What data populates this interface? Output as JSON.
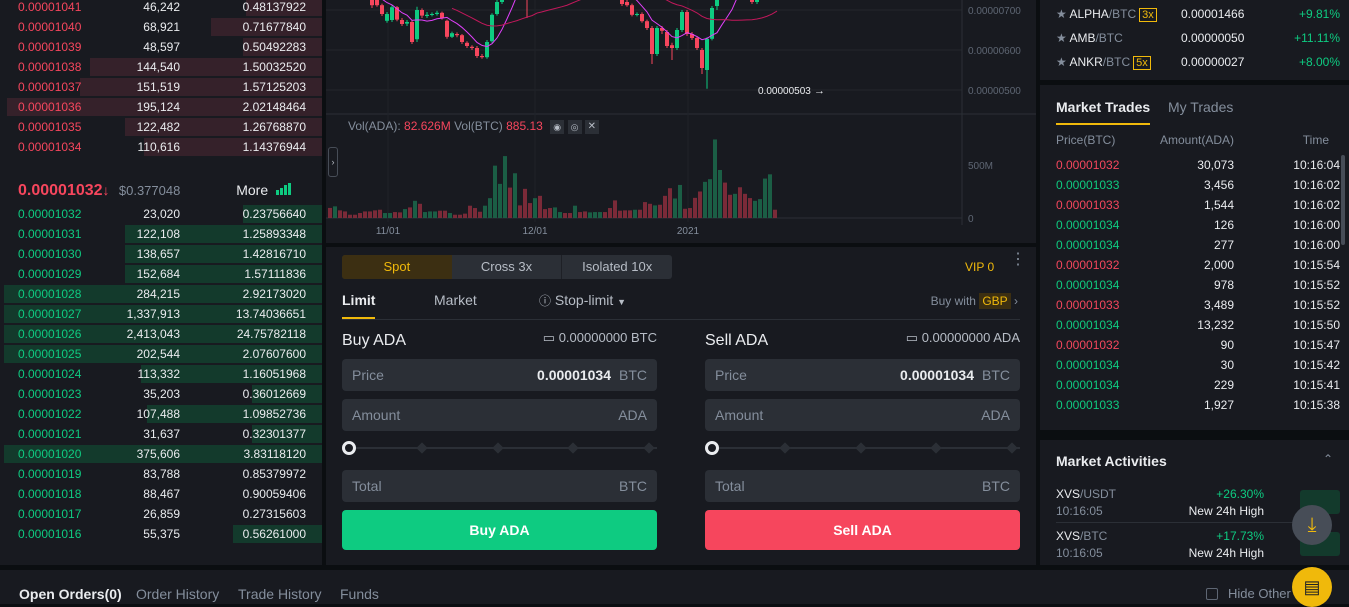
{
  "orderbook": {
    "asks": [
      {
        "price": "0.00001041",
        "amount": "46,242",
        "total": "0.48137922",
        "depth": 0.24
      },
      {
        "price": "0.00001040",
        "amount": "68,921",
        "total": "0.71677840",
        "depth": 0.35
      },
      {
        "price": "0.00001039",
        "amount": "48,597",
        "total": "0.50492283",
        "depth": 0.25
      },
      {
        "price": "0.00001038",
        "amount": "144,540",
        "total": "1.50032520",
        "depth": 0.73
      },
      {
        "price": "0.00001037",
        "amount": "151,519",
        "total": "1.57125203",
        "depth": 0.76
      },
      {
        "price": "0.00001036",
        "amount": "195,124",
        "total": "2.02148464",
        "depth": 0.99
      },
      {
        "price": "0.00001035",
        "amount": "122,482",
        "total": "1.26768870",
        "depth": 0.62
      },
      {
        "price": "0.00001034",
        "amount": "110,616",
        "total": "1.14376944",
        "depth": 0.56
      }
    ],
    "last_price": "0.00001032",
    "last_arrow": "↓",
    "last_usd": "$0.377048",
    "more": "More",
    "bids": [
      {
        "price": "0.00001032",
        "amount": "23,020",
        "total": "0.23756640",
        "depth": 0.25
      },
      {
        "price": "0.00001031",
        "amount": "122,108",
        "total": "1.25893348",
        "depth": 0.62
      },
      {
        "price": "0.00001030",
        "amount": "138,657",
        "total": "1.42816710",
        "depth": 0.62
      },
      {
        "price": "0.00001029",
        "amount": "152,684",
        "total": "1.57111836",
        "depth": 0.62
      },
      {
        "price": "0.00001028",
        "amount": "284,215",
        "total": "2.92173020",
        "depth": 1
      },
      {
        "price": "0.00001027",
        "amount": "1,337,913",
        "total": "13.74036651",
        "depth": 1
      },
      {
        "price": "0.00001026",
        "amount": "2,413,043",
        "total": "24.75782118",
        "depth": 1
      },
      {
        "price": "0.00001025",
        "amount": "202,544",
        "total": "2.07607600",
        "depth": 1
      },
      {
        "price": "0.00001024",
        "amount": "113,332",
        "total": "1.16051968",
        "depth": 0.57
      },
      {
        "price": "0.00001023",
        "amount": "35,203",
        "total": "0.36012669",
        "depth": 0.22
      },
      {
        "price": "0.00001022",
        "amount": "107,488",
        "total": "1.09852736",
        "depth": 0.55
      },
      {
        "price": "0.00001021",
        "amount": "31,637",
        "total": "0.32301377",
        "depth": 0.22
      },
      {
        "price": "0.00001020",
        "amount": "375,606",
        "total": "3.83118120",
        "depth": 1
      },
      {
        "price": "0.00001019",
        "amount": "83,788",
        "total": "0.85379972",
        "depth": 0
      },
      {
        "price": "0.00001018",
        "amount": "88,467",
        "total": "0.90059406",
        "depth": 0
      },
      {
        "price": "0.00001017",
        "amount": "26,859",
        "total": "0.27315603",
        "depth": 0
      },
      {
        "price": "0.00001016",
        "amount": "55,375",
        "total": "0.56261000",
        "depth": 0.28
      }
    ]
  },
  "chart": {
    "price_ticks": [
      "0.00000700",
      "0.00000600",
      "0.00000500"
    ],
    "low_marker": "0.00000503",
    "vol_label": "Vol(ADA):",
    "vol_ada": "82.626M",
    "vol_btc_label": "Vol(BTC)",
    "vol_btc": "885.13",
    "vol_ticks": [
      "500M",
      "0"
    ],
    "date_ticks": [
      "11/01",
      "12/01",
      "2021"
    ],
    "colors": {
      "up": "#0ecb81",
      "down": "#f6465d",
      "ma1": "#e040fb",
      "ma2": "#c2185b"
    }
  },
  "chart_data": {
    "type": "candlestick",
    "price_unit": "1e-8 BTC",
    "candles": [
      [
        780,
        770,
        790,
        760
      ],
      [
        770,
        775,
        785,
        765
      ],
      [
        775,
        768,
        780,
        760
      ],
      [
        768,
        760,
        772,
        750
      ],
      [
        760,
        752,
        765,
        745
      ],
      [
        752,
        748,
        758,
        740
      ],
      [
        748,
        742,
        752,
        736
      ],
      [
        742,
        735,
        748,
        730
      ],
      [
        730,
        712,
        740,
        705
      ],
      [
        725,
        712,
        730,
        708
      ],
      [
        712,
        690,
        716,
        685
      ],
      [
        673,
        690,
        695,
        668
      ],
      [
        675,
        707,
        712,
        670
      ],
      [
        707,
        676,
        710,
        672
      ],
      [
        675,
        665,
        680,
        660
      ],
      [
        666,
        670,
        675,
        660
      ],
      [
        670,
        620,
        675,
        615
      ],
      [
        627,
        700,
        708,
        620
      ],
      [
        700,
        686,
        704,
        680
      ],
      [
        685,
        688,
        695,
        680
      ],
      [
        688,
        690,
        694,
        684
      ],
      [
        690,
        693,
        698,
        686
      ],
      [
        693,
        680,
        696,
        676
      ],
      [
        673,
        633,
        676,
        628
      ],
      [
        633,
        642,
        646,
        630
      ],
      [
        640,
        637,
        644,
        632
      ],
      [
        637,
        620,
        640,
        615
      ],
      [
        618,
        610,
        622,
        605
      ],
      [
        608,
        605,
        612,
        600
      ],
      [
        605,
        585,
        610,
        580
      ],
      [
        585,
        582,
        590,
        578
      ],
      [
        582,
        620,
        625,
        578
      ],
      [
        622,
        688,
        692,
        618
      ],
      [
        690,
        720,
        730,
        686
      ],
      [
        720,
        760,
        770,
        715
      ],
      [
        760,
        790,
        800,
        755
      ],
      [
        790,
        780,
        800,
        770
      ],
      [
        780,
        795,
        805,
        775
      ],
      [
        795,
        790,
        800,
        785
      ],
      [
        790,
        770,
        795,
        680
      ],
      [
        770,
        765,
        780,
        760
      ],
      [
        765,
        780,
        785,
        760
      ],
      [
        780,
        775,
        790,
        770
      ],
      [
        775,
        770,
        782,
        765
      ],
      [
        770,
        765,
        775,
        760
      ],
      [
        765,
        770,
        775,
        760
      ],
      [
        770,
        775,
        780,
        765
      ],
      [
        775,
        770,
        780,
        765
      ],
      [
        770,
        765,
        775,
        760
      ],
      [
        765,
        770,
        775,
        760
      ],
      [
        770,
        765,
        775,
        760
      ],
      [
        765,
        760,
        770,
        755
      ],
      [
        760,
        765,
        770,
        755
      ],
      [
        765,
        768,
        772,
        760
      ],
      [
        768,
        772,
        776,
        764
      ],
      [
        772,
        770,
        776,
        765
      ],
      [
        770,
        755,
        775,
        750
      ],
      [
        755,
        735,
        760,
        730
      ],
      [
        735,
        715,
        740,
        710
      ],
      [
        720,
        712,
        725,
        708
      ],
      [
        712,
        688,
        716,
        684
      ],
      [
        688,
        690,
        694,
        684
      ],
      [
        690,
        672,
        694,
        668
      ],
      [
        672,
        655,
        676,
        650
      ],
      [
        655,
        590,
        660,
        565
      ],
      [
        590,
        655,
        660,
        585
      ],
      [
        655,
        648,
        660,
        640
      ],
      [
        645,
        610,
        650,
        605
      ],
      [
        612,
        605,
        618,
        575
      ],
      [
        605,
        650,
        655,
        600
      ],
      [
        650,
        695,
        700,
        645
      ],
      [
        695,
        640,
        700,
        635
      ],
      [
        640,
        630,
        645,
        625
      ],
      [
        630,
        605,
        635,
        600
      ],
      [
        600,
        555,
        605,
        540
      ],
      [
        550,
        628,
        632,
        503
      ],
      [
        628,
        705,
        710,
        624
      ],
      [
        710,
        740,
        745,
        700
      ],
      [
        740,
        780,
        790,
        735
      ],
      [
        780,
        760,
        790,
        750
      ],
      [
        760,
        740,
        765,
        730
      ],
      [
        740,
        755,
        760,
        735
      ],
      [
        755,
        745,
        760,
        740
      ],
      [
        745,
        730,
        750,
        725
      ],
      [
        730,
        720,
        735,
        715
      ],
      [
        720,
        735,
        740,
        715
      ],
      [
        735,
        760,
        765,
        730
      ],
      [
        760,
        775,
        780,
        755
      ],
      [
        775,
        790,
        795,
        770
      ],
      [
        790,
        780,
        795,
        775
      ]
    ],
    "volume_millions": [
      95,
      110,
      72,
      62,
      31,
      31,
      47,
      62,
      62,
      72,
      78,
      47,
      47,
      56,
      53,
      84,
      100,
      162,
      134,
      56,
      62,
      62,
      69,
      69,
      47,
      31,
      31,
      41,
      116,
      94,
      59,
      116,
      187,
      494,
      322,
      584,
      287,
      422,
      119,
      275,
      141,
      187,
      209,
      84,
      94,
      100,
      56,
      47,
      47,
      116,
      56,
      62,
      53,
      56,
      56,
      56,
      94,
      166,
      69,
      72,
      72,
      78,
      78,
      150,
      134,
      119,
      125,
      209,
      281,
      184,
      312,
      87,
      94,
      190,
      250,
      341,
      366,
      741,
      453,
      334,
      219,
      228,
      290,
      228,
      188,
      162,
      178,
      372,
      412,
      78
    ]
  },
  "form": {
    "modes": [
      "Spot",
      "Cross 3x",
      "Isolated 10x"
    ],
    "vip": "VIP 0",
    "tabs": [
      "Limit",
      "Market",
      "Stop-limit"
    ],
    "buy_with": "Buy with",
    "currency": "GBP",
    "buy": {
      "title": "Buy ADA",
      "balance": "0.00000000 BTC",
      "price_label": "Price",
      "price": "0.00001034",
      "price_unit": "BTC",
      "amount_label": "Amount",
      "amount_unit": "ADA",
      "total_label": "Total",
      "total_unit": "BTC",
      "button": "Buy ADA",
      "slider": 0
    },
    "sell": {
      "title": "Sell ADA",
      "balance": "0.00000000 ADA",
      "price_label": "Price",
      "price": "0.00001034",
      "price_unit": "BTC",
      "amount_label": "Amount",
      "amount_unit": "ADA",
      "total_label": "Total",
      "total_unit": "BTC",
      "button": "Sell ADA",
      "slider": 0
    }
  },
  "pairs": [
    {
      "base": "ALPHA",
      "quote": "/BTC",
      "lev": "3x",
      "price": "0.00001466",
      "change": "+9.81%"
    },
    {
      "base": "AMB",
      "quote": "/BTC",
      "lev": "",
      "price": "0.00000050",
      "change": "+11.11%"
    },
    {
      "base": "ANKR",
      "quote": "/BTC",
      "lev": "5x",
      "price": "0.00000027",
      "change": "+8.00%"
    }
  ],
  "trades": {
    "tabs": [
      "Market Trades",
      "My Trades"
    ],
    "headers": [
      "Price(BTC)",
      "Amount(ADA)",
      "Time"
    ],
    "rows": [
      {
        "price": "0.00001032",
        "amount": "30,073",
        "time": "10:16:04",
        "side": "sell"
      },
      {
        "price": "0.00001033",
        "amount": "3,456",
        "time": "10:16:02",
        "side": "buy"
      },
      {
        "price": "0.00001033",
        "amount": "1,544",
        "time": "10:16:02",
        "side": "sell"
      },
      {
        "price": "0.00001034",
        "amount": "126",
        "time": "10:16:00",
        "side": "buy"
      },
      {
        "price": "0.00001034",
        "amount": "277",
        "time": "10:16:00",
        "side": "buy"
      },
      {
        "price": "0.00001032",
        "amount": "2,000",
        "time": "10:15:54",
        "side": "sell"
      },
      {
        "price": "0.00001034",
        "amount": "978",
        "time": "10:15:52",
        "side": "buy"
      },
      {
        "price": "0.00001033",
        "amount": "3,489",
        "time": "10:15:52",
        "side": "sell"
      },
      {
        "price": "0.00001034",
        "amount": "13,232",
        "time": "10:15:50",
        "side": "buy"
      },
      {
        "price": "0.00001032",
        "amount": "90",
        "time": "10:15:47",
        "side": "sell"
      },
      {
        "price": "0.00001034",
        "amount": "30",
        "time": "10:15:42",
        "side": "buy"
      },
      {
        "price": "0.00001034",
        "amount": "229",
        "time": "10:15:41",
        "side": "buy"
      },
      {
        "price": "0.00001033",
        "amount": "1,927",
        "time": "10:15:38",
        "side": "buy"
      }
    ]
  },
  "activities": {
    "title": "Market Activities",
    "items": [
      {
        "base": "XVS",
        "quote": "/USDT",
        "time": "10:16:05",
        "change": "+26.30%",
        "event": "New 24h High"
      },
      {
        "base": "XVS",
        "quote": "/BTC",
        "time": "10:16:05",
        "change": "+17.73%",
        "event": "New 24h High"
      }
    ]
  },
  "bottom": {
    "tabs": [
      "Open Orders(0)",
      "Order History",
      "Trade History",
      "Funds"
    ],
    "hide_other": "Hide Other Pairs"
  }
}
